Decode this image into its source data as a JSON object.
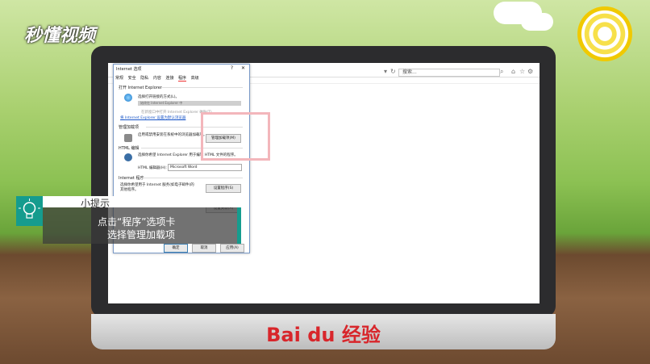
{
  "brand": "秒懂视频",
  "footer_brand": "Bai du 经验",
  "browser": {
    "search_text": "搜索..."
  },
  "dialog": {
    "title": "Internet 选项",
    "help": "?",
    "close": "✕",
    "tabs": [
      "常规",
      "安全",
      "隐私",
      "内容",
      "连接",
      "程序",
      "高级"
    ],
    "sections": {
      "open_ie": {
        "label": "打开 Internet Explorer",
        "desc": "选择打开链接的方式(L)。",
        "value": "始终在 Internet Explorer 中",
        "check": "在新窗口中打开 Internet Explorer 磁贴(T)",
        "link": "将 Internet Explorer 设置为默认浏览器"
      },
      "addons": {
        "label": "管理加载项",
        "desc": "启用或禁用安装在系统中的浏览器加载项。",
        "button": "管理加载项(M)"
      },
      "html": {
        "label": "HTML 编辑",
        "desc": "选择你希望 Internet Explorer 用于编辑 HTML 文件的程序。",
        "editor_label": "HTML 编辑器(H):",
        "editor_value": "Microsoft Word"
      },
      "programs": {
        "label": "Internet 程序",
        "desc": "选择你希望用于 Internet 服务(如电子邮件)的其他程序。",
        "button": "设置程序(S)"
      },
      "file_assoc": {
        "button": "设置关联(A)"
      }
    },
    "ok": "确定",
    "cancel": "取消",
    "apply": "应用(A)"
  },
  "tip": {
    "title": "小提示",
    "line1": "点击“程序”选项卡",
    "line2": "选择管理加载项"
  }
}
